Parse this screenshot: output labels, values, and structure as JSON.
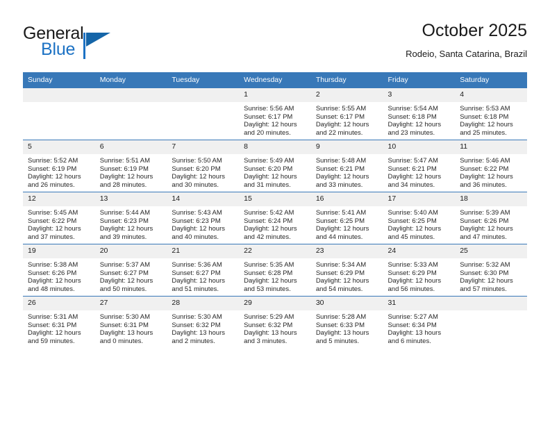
{
  "brand": {
    "word_one": "General",
    "word_two": "Blue",
    "flag_icon": "triangle-flag-icon",
    "primary_color": "#1c72c4"
  },
  "header": {
    "title": "October 2025",
    "location": "Rodeio, Santa Catarina, Brazil"
  },
  "calendar": {
    "header_color": "#3878b8",
    "daynum_bg": "#f0f0f0",
    "weekday_headers": [
      "Sunday",
      "Monday",
      "Tuesday",
      "Wednesday",
      "Thursday",
      "Friday",
      "Saturday"
    ],
    "weeks": [
      [
        {
          "day": "",
          "empty": true
        },
        {
          "day": "",
          "empty": true
        },
        {
          "day": "",
          "empty": true
        },
        {
          "day": "1",
          "sunrise": "Sunrise: 5:56 AM",
          "sunset": "Sunset: 6:17 PM",
          "daylight": "Daylight: 12 hours and 20 minutes."
        },
        {
          "day": "2",
          "sunrise": "Sunrise: 5:55 AM",
          "sunset": "Sunset: 6:17 PM",
          "daylight": "Daylight: 12 hours and 22 minutes."
        },
        {
          "day": "3",
          "sunrise": "Sunrise: 5:54 AM",
          "sunset": "Sunset: 6:18 PM",
          "daylight": "Daylight: 12 hours and 23 minutes."
        },
        {
          "day": "4",
          "sunrise": "Sunrise: 5:53 AM",
          "sunset": "Sunset: 6:18 PM",
          "daylight": "Daylight: 12 hours and 25 minutes."
        }
      ],
      [
        {
          "day": "5",
          "sunrise": "Sunrise: 5:52 AM",
          "sunset": "Sunset: 6:19 PM",
          "daylight": "Daylight: 12 hours and 26 minutes."
        },
        {
          "day": "6",
          "sunrise": "Sunrise: 5:51 AM",
          "sunset": "Sunset: 6:19 PM",
          "daylight": "Daylight: 12 hours and 28 minutes."
        },
        {
          "day": "7",
          "sunrise": "Sunrise: 5:50 AM",
          "sunset": "Sunset: 6:20 PM",
          "daylight": "Daylight: 12 hours and 30 minutes."
        },
        {
          "day": "8",
          "sunrise": "Sunrise: 5:49 AM",
          "sunset": "Sunset: 6:20 PM",
          "daylight": "Daylight: 12 hours and 31 minutes."
        },
        {
          "day": "9",
          "sunrise": "Sunrise: 5:48 AM",
          "sunset": "Sunset: 6:21 PM",
          "daylight": "Daylight: 12 hours and 33 minutes."
        },
        {
          "day": "10",
          "sunrise": "Sunrise: 5:47 AM",
          "sunset": "Sunset: 6:21 PM",
          "daylight": "Daylight: 12 hours and 34 minutes."
        },
        {
          "day": "11",
          "sunrise": "Sunrise: 5:46 AM",
          "sunset": "Sunset: 6:22 PM",
          "daylight": "Daylight: 12 hours and 36 minutes."
        }
      ],
      [
        {
          "day": "12",
          "sunrise": "Sunrise: 5:45 AM",
          "sunset": "Sunset: 6:22 PM",
          "daylight": "Daylight: 12 hours and 37 minutes."
        },
        {
          "day": "13",
          "sunrise": "Sunrise: 5:44 AM",
          "sunset": "Sunset: 6:23 PM",
          "daylight": "Daylight: 12 hours and 39 minutes."
        },
        {
          "day": "14",
          "sunrise": "Sunrise: 5:43 AM",
          "sunset": "Sunset: 6:23 PM",
          "daylight": "Daylight: 12 hours and 40 minutes."
        },
        {
          "day": "15",
          "sunrise": "Sunrise: 5:42 AM",
          "sunset": "Sunset: 6:24 PM",
          "daylight": "Daylight: 12 hours and 42 minutes."
        },
        {
          "day": "16",
          "sunrise": "Sunrise: 5:41 AM",
          "sunset": "Sunset: 6:25 PM",
          "daylight": "Daylight: 12 hours and 44 minutes."
        },
        {
          "day": "17",
          "sunrise": "Sunrise: 5:40 AM",
          "sunset": "Sunset: 6:25 PM",
          "daylight": "Daylight: 12 hours and 45 minutes."
        },
        {
          "day": "18",
          "sunrise": "Sunrise: 5:39 AM",
          "sunset": "Sunset: 6:26 PM",
          "daylight": "Daylight: 12 hours and 47 minutes."
        }
      ],
      [
        {
          "day": "19",
          "sunrise": "Sunrise: 5:38 AM",
          "sunset": "Sunset: 6:26 PM",
          "daylight": "Daylight: 12 hours and 48 minutes."
        },
        {
          "day": "20",
          "sunrise": "Sunrise: 5:37 AM",
          "sunset": "Sunset: 6:27 PM",
          "daylight": "Daylight: 12 hours and 50 minutes."
        },
        {
          "day": "21",
          "sunrise": "Sunrise: 5:36 AM",
          "sunset": "Sunset: 6:27 PM",
          "daylight": "Daylight: 12 hours and 51 minutes."
        },
        {
          "day": "22",
          "sunrise": "Sunrise: 5:35 AM",
          "sunset": "Sunset: 6:28 PM",
          "daylight": "Daylight: 12 hours and 53 minutes."
        },
        {
          "day": "23",
          "sunrise": "Sunrise: 5:34 AM",
          "sunset": "Sunset: 6:29 PM",
          "daylight": "Daylight: 12 hours and 54 minutes."
        },
        {
          "day": "24",
          "sunrise": "Sunrise: 5:33 AM",
          "sunset": "Sunset: 6:29 PM",
          "daylight": "Daylight: 12 hours and 56 minutes."
        },
        {
          "day": "25",
          "sunrise": "Sunrise: 5:32 AM",
          "sunset": "Sunset: 6:30 PM",
          "daylight": "Daylight: 12 hours and 57 minutes."
        }
      ],
      [
        {
          "day": "26",
          "sunrise": "Sunrise: 5:31 AM",
          "sunset": "Sunset: 6:31 PM",
          "daylight": "Daylight: 12 hours and 59 minutes."
        },
        {
          "day": "27",
          "sunrise": "Sunrise: 5:30 AM",
          "sunset": "Sunset: 6:31 PM",
          "daylight": "Daylight: 13 hours and 0 minutes."
        },
        {
          "day": "28",
          "sunrise": "Sunrise: 5:30 AM",
          "sunset": "Sunset: 6:32 PM",
          "daylight": "Daylight: 13 hours and 2 minutes."
        },
        {
          "day": "29",
          "sunrise": "Sunrise: 5:29 AM",
          "sunset": "Sunset: 6:32 PM",
          "daylight": "Daylight: 13 hours and 3 minutes."
        },
        {
          "day": "30",
          "sunrise": "Sunrise: 5:28 AM",
          "sunset": "Sunset: 6:33 PM",
          "daylight": "Daylight: 13 hours and 5 minutes."
        },
        {
          "day": "31",
          "sunrise": "Sunrise: 5:27 AM",
          "sunset": "Sunset: 6:34 PM",
          "daylight": "Daylight: 13 hours and 6 minutes."
        },
        {
          "day": "",
          "empty": true
        }
      ]
    ]
  }
}
